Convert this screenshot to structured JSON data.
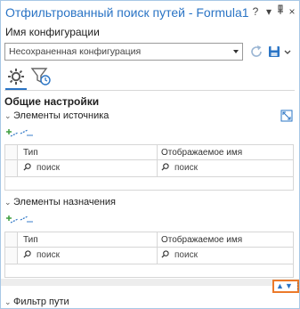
{
  "window": {
    "title": "Отфильтрованный поиск путей - Formula1",
    "help_label": "?",
    "menu_label": "▾",
    "pin_label": "⊥",
    "close_label": "×"
  },
  "config": {
    "label": "Имя конфигурации",
    "selected_value": "Несохраненная конфигурация"
  },
  "tabs": [
    {
      "icon": "gear-icon",
      "active": true
    },
    {
      "icon": "filter-clock-icon",
      "active": false
    }
  ],
  "section": {
    "title": "Общие настройки"
  },
  "source": {
    "label": "Элементы источника",
    "columns": [
      "Тип",
      "Отображаемое имя"
    ],
    "rows": [
      {
        "type_placeholder": "поиск",
        "name_placeholder": "поиск"
      }
    ]
  },
  "target": {
    "label": "Элементы назначения",
    "columns": [
      "Тип",
      "Отображаемое имя"
    ],
    "rows": [
      {
        "type_placeholder": "поиск",
        "name_placeholder": "поиск"
      }
    ]
  },
  "filter": {
    "label": "Фильтр пути"
  },
  "colors": {
    "accent": "#2a74c5",
    "highlight": "#ec7a2a",
    "add_green": "#3e9e3e"
  }
}
